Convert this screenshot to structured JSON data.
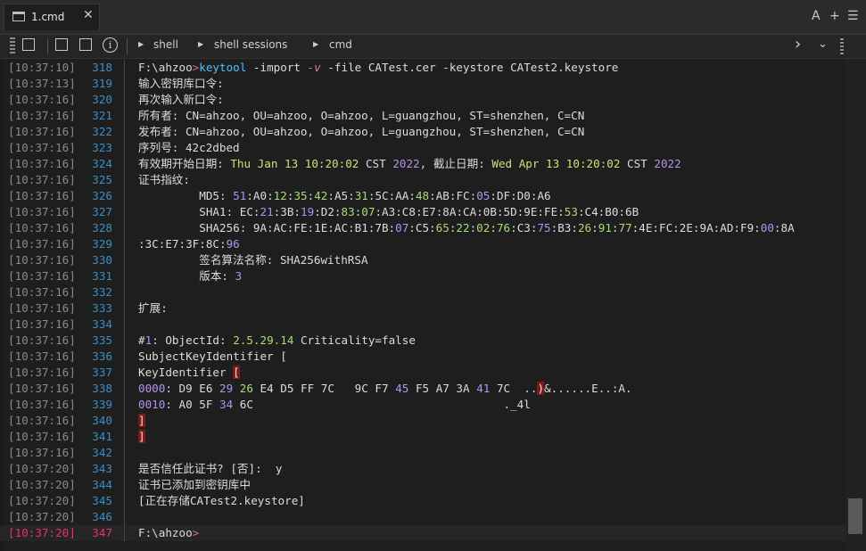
{
  "tab": {
    "title": "1.cmd",
    "close": "✕"
  },
  "window_controls": {
    "font": "A",
    "add": "+",
    "menu": "☰"
  },
  "toolbar": {
    "crumbs": [
      "shell",
      "shell sessions",
      "cmd"
    ]
  },
  "lines": [
    {
      "ts": "[10:37:10]",
      "ln": "318",
      "parts": [
        [
          "F:\\ahzoo",
          ""
        ],
        [
          ">",
          "gt"
        ],
        [
          "keytool",
          "kw"
        ],
        [
          " -import ",
          ""
        ],
        [
          "-v",
          "opt"
        ],
        [
          " -file CATest.cer -keystore CATest2.keystore",
          ""
        ]
      ]
    },
    {
      "ts": "[10:37:13]",
      "ln": "319",
      "parts": [
        [
          "输入密钥库口令:",
          ""
        ]
      ]
    },
    {
      "ts": "[10:37:16]",
      "ln": "320",
      "parts": [
        [
          "再次输入新口令:",
          ""
        ]
      ]
    },
    {
      "ts": "[10:37:16]",
      "ln": "321",
      "parts": [
        [
          "所有者: CN=ahzoo, OU=ahzoo, O=ahzoo, L=guangzhou, ST=shenzhen, C=CN",
          ""
        ]
      ]
    },
    {
      "ts": "[10:37:16]",
      "ln": "322",
      "parts": [
        [
          "发布者: CN=ahzoo, OU=ahzoo, O=ahzoo, L=guangzhou, ST=shenzhen, C=CN",
          ""
        ]
      ]
    },
    {
      "ts": "[10:37:16]",
      "ln": "323",
      "parts": [
        [
          "序列号: 42c2dbed",
          ""
        ]
      ]
    },
    {
      "ts": "[10:37:16]",
      "ln": "324",
      "parts": [
        [
          "有效期开始日期: ",
          ""
        ],
        [
          "Thu Jan 13 10:20:02",
          "y"
        ],
        [
          " CST ",
          ""
        ],
        [
          "2022",
          "pur"
        ],
        [
          ", 截止日期: ",
          ""
        ],
        [
          "Wed Apr 13 10:20:02",
          "y"
        ],
        [
          " CST ",
          ""
        ],
        [
          "2022",
          "pur"
        ]
      ]
    },
    {
      "ts": "[10:37:16]",
      "ln": "325",
      "parts": [
        [
          "证书指纹:",
          ""
        ]
      ]
    },
    {
      "ts": "[10:37:16]",
      "ln": "326",
      "parts": [
        [
          "         MD5: ",
          ""
        ],
        [
          "51",
          "pur"
        ],
        [
          ":A0:",
          ""
        ],
        [
          "12",
          "num"
        ],
        [
          ":",
          ""
        ],
        [
          "35",
          "num"
        ],
        [
          ":",
          ""
        ],
        [
          "42",
          "num"
        ],
        [
          ":A5:",
          ""
        ],
        [
          "31",
          "num"
        ],
        [
          ":5C:AA:",
          ""
        ],
        [
          "48",
          "num"
        ],
        [
          ":AB:FC:",
          ""
        ],
        [
          "05",
          "pur"
        ],
        [
          ":DF:D0:A6",
          ""
        ]
      ]
    },
    {
      "ts": "[10:37:16]",
      "ln": "327",
      "parts": [
        [
          "         SHA1: EC:",
          ""
        ],
        [
          "21",
          "pur"
        ],
        [
          ":3B:",
          ""
        ],
        [
          "19",
          "pur"
        ],
        [
          ":D2:",
          ""
        ],
        [
          "83",
          "num"
        ],
        [
          ":",
          ""
        ],
        [
          "07",
          "num"
        ],
        [
          ":A3:C8:E7:8A:CA:0B:5D:9E:FE:",
          ""
        ],
        [
          "53",
          "num"
        ],
        [
          ":C4:B0:6B",
          ""
        ]
      ]
    },
    {
      "ts": "[10:37:16]",
      "ln": "328",
      "parts": [
        [
          "         SHA256: 9A:AC:FE:1E:AC:B1:7B:",
          ""
        ],
        [
          "07",
          "pur"
        ],
        [
          ":C5:",
          ""
        ],
        [
          "65",
          "num"
        ],
        [
          ":",
          ""
        ],
        [
          "22",
          "num"
        ],
        [
          ":",
          ""
        ],
        [
          "02",
          "num"
        ],
        [
          ":",
          ""
        ],
        [
          "76",
          "num"
        ],
        [
          ":C3:",
          ""
        ],
        [
          "75",
          "pur"
        ],
        [
          ":B3:",
          ""
        ],
        [
          "26",
          "num"
        ],
        [
          ":",
          ""
        ],
        [
          "91",
          "num"
        ],
        [
          ":",
          ""
        ],
        [
          "77",
          "num"
        ],
        [
          ":4E:FC:2E:9A:AD:F9:",
          ""
        ],
        [
          "00",
          "pur"
        ],
        [
          ":8A",
          ""
        ]
      ]
    },
    {
      "ts": "[10:37:16]",
      "ln": "329",
      "parts": [
        [
          ":3C:E7:3F:8C:",
          ""
        ],
        [
          "96",
          "pur"
        ]
      ],
      "wrap": true
    },
    {
      "ts": "[10:37:16]",
      "ln": "330",
      "parts": [
        [
          "         签名算法名称: SHA256withRSA",
          ""
        ]
      ]
    },
    {
      "ts": "[10:37:16]",
      "ln": "331",
      "parts": [
        [
          "         版本: ",
          ""
        ],
        [
          "3",
          "pur"
        ]
      ]
    },
    {
      "ts": "[10:37:16]",
      "ln": "332",
      "parts": []
    },
    {
      "ts": "[10:37:16]",
      "ln": "333",
      "parts": [
        [
          "扩展:",
          ""
        ]
      ]
    },
    {
      "ts": "[10:37:16]",
      "ln": "334",
      "parts": []
    },
    {
      "ts": "[10:37:16]",
      "ln": "335",
      "parts": [
        [
          "#",
          ""
        ],
        [
          "1",
          "pur"
        ],
        [
          ": ObjectId: ",
          ""
        ],
        [
          "2.5.29.14",
          "num"
        ],
        [
          " Criticality=false",
          ""
        ]
      ]
    },
    {
      "ts": "[10:37:16]",
      "ln": "336",
      "parts": [
        [
          "SubjectKeyIdentifier [",
          ""
        ]
      ]
    },
    {
      "ts": "[10:37:16]",
      "ln": "337",
      "parts": [
        [
          "KeyIdentifier ",
          ""
        ],
        [
          "[",
          "br"
        ]
      ]
    },
    {
      "ts": "[10:37:16]",
      "ln": "338",
      "parts": [
        [
          "0000",
          "pur"
        ],
        [
          ": D9 E6 ",
          ""
        ],
        [
          "29",
          "pur"
        ],
        [
          " ",
          ""
        ],
        [
          "26",
          "num"
        ],
        [
          " E4 D5 FF 7C   9C F7 ",
          ""
        ],
        [
          "45",
          "pur"
        ],
        [
          " F5 A7 3A ",
          ""
        ],
        [
          "41",
          "pur"
        ],
        [
          " 7C  ..",
          ""
        ],
        [
          ")",
          "br"
        ],
        [
          "&......E..:A.",
          ""
        ]
      ]
    },
    {
      "ts": "[10:37:16]",
      "ln": "339",
      "parts": [
        [
          "0010",
          "pur"
        ],
        [
          ": A0 5F ",
          ""
        ],
        [
          "34",
          "pur"
        ],
        [
          " 6C                                     ._4l",
          ""
        ]
      ]
    },
    {
      "ts": "[10:37:16]",
      "ln": "340",
      "parts": [
        [
          "]",
          "br"
        ]
      ]
    },
    {
      "ts": "[10:37:16]",
      "ln": "341",
      "parts": [
        [
          "]",
          "br"
        ]
      ]
    },
    {
      "ts": "[10:37:16]",
      "ln": "342",
      "parts": []
    },
    {
      "ts": "[10:37:20]",
      "ln": "343",
      "parts": [
        [
          "是否信任此证书? [否]:  y",
          ""
        ]
      ]
    },
    {
      "ts": "[10:37:20]",
      "ln": "344",
      "parts": [
        [
          "证书已添加到密钥库中",
          ""
        ]
      ]
    },
    {
      "ts": "[10:37:20]",
      "ln": "345",
      "parts": [
        [
          "[正在存储CATest2.keystore]",
          ""
        ]
      ]
    },
    {
      "ts": "[10:37:20]",
      "ln": "346",
      "parts": []
    },
    {
      "ts": "[10:37:20]",
      "ln": "347",
      "parts": [
        [
          "F:\\ahzoo",
          ""
        ],
        [
          ">",
          "gt"
        ]
      ],
      "current": true
    }
  ]
}
